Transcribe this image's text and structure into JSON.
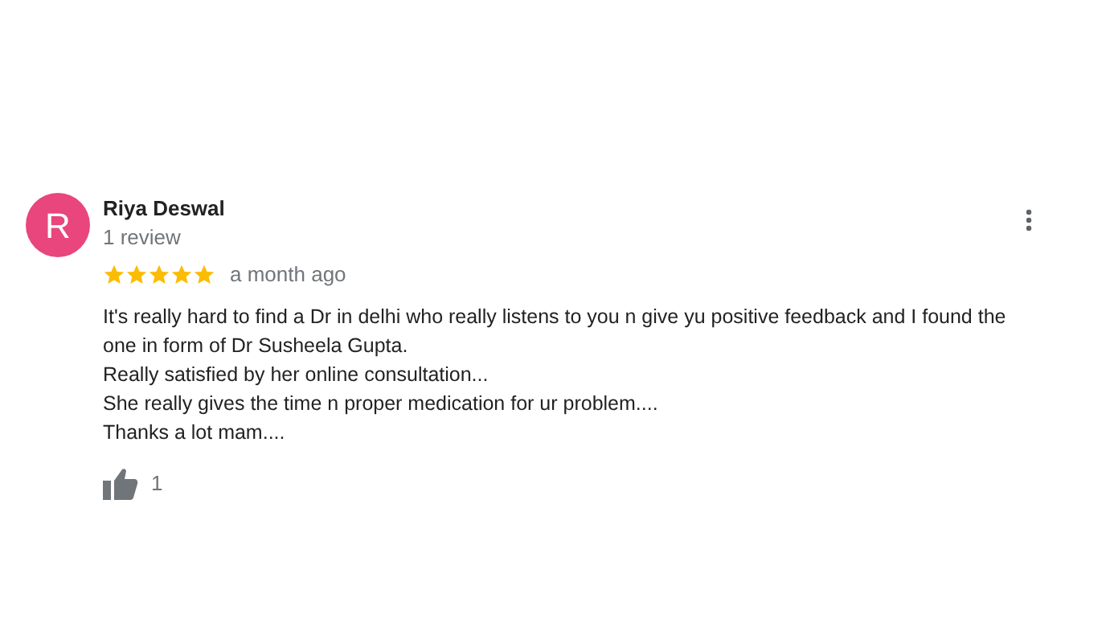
{
  "review": {
    "avatar_letter": "R",
    "author": "Riya Deswal",
    "author_meta": "1 review",
    "stars": 5,
    "time": "a month ago",
    "paragraphs": [
      "It's really hard to find a Dr in delhi who really listens to you n give yu positive feedback and I found the one in form of Dr Susheela Gupta.",
      "Really satisfied by her online consultation...",
      "She really gives the time n proper medication for ur problem....",
      "Thanks a lot mam...."
    ],
    "like_count": "1"
  }
}
